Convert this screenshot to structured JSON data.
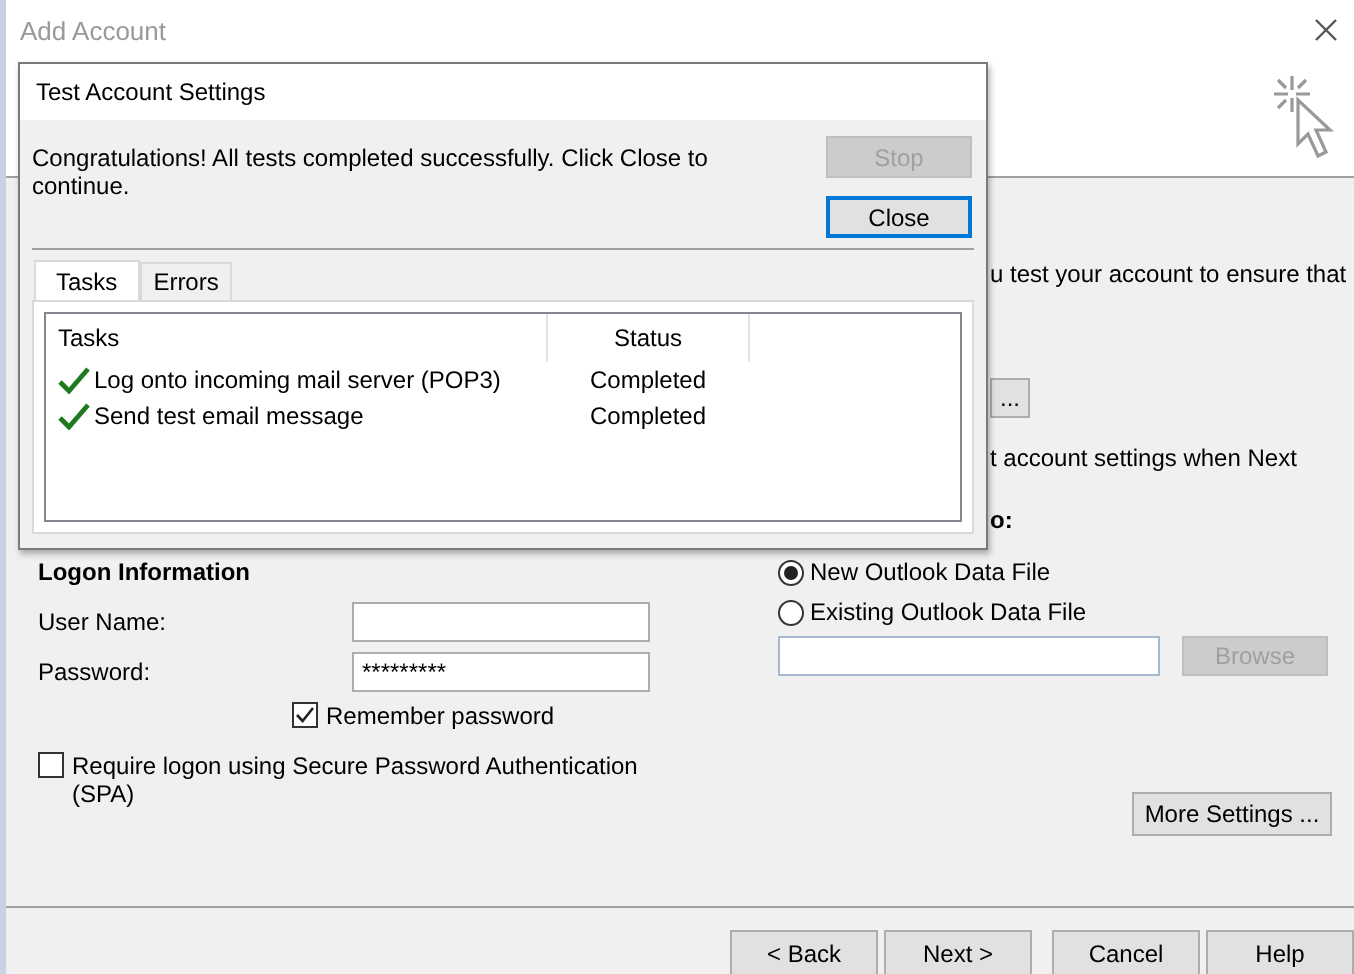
{
  "window": {
    "title": "Add Account"
  },
  "partially_hidden": [
    {
      "kind": "text",
      "text": "u test your account to ensure that"
    },
    {
      "kind": "button",
      "text": "..."
    },
    {
      "kind": "text",
      "text": "t account settings when Next"
    },
    {
      "kind": "heading",
      "text": "o:"
    }
  ],
  "logon": {
    "heading": "Logon Information",
    "user_name": {
      "label": "User Name:"
    },
    "password": {
      "label": "Password:",
      "value": "*********"
    },
    "remember": {
      "label": "Remember password",
      "checked": true
    },
    "spa": {
      "label": "Require logon using Secure Password Authentication (SPA)",
      "checked": false
    }
  },
  "deliver": {
    "options": [
      {
        "label": "New Outlook Data File",
        "selected": true
      },
      {
        "label": "Existing Outlook Data File",
        "selected": false
      }
    ],
    "browse": {
      "label": "Browse",
      "disabled": true
    }
  },
  "more_settings": {
    "label": "More Settings ..."
  },
  "button_groups": [
    [
      {
        "label": "< Back"
      },
      {
        "label": "Next >"
      }
    ],
    [
      {
        "label": "Cancel"
      },
      {
        "label": "Help"
      }
    ]
  ],
  "dialog": {
    "title": "Test Account Settings",
    "message": "Congratulations! All tests completed successfully. Click Close to continue.",
    "buttons": [
      {
        "label": "Stop",
        "disabled": true,
        "focused": false
      },
      {
        "label": "Close",
        "disabled": false,
        "focused": true
      }
    ],
    "tabs": [
      {
        "label": "Tasks",
        "selected": true
      },
      {
        "label": "Errors",
        "selected": false
      }
    ],
    "columns": [
      "Tasks",
      "Status"
    ],
    "rows": [
      {
        "task": "Log onto incoming mail server (POP3)",
        "status": "Completed",
        "done": true
      },
      {
        "task": "Send test email message",
        "status": "Completed",
        "done": true
      }
    ]
  }
}
